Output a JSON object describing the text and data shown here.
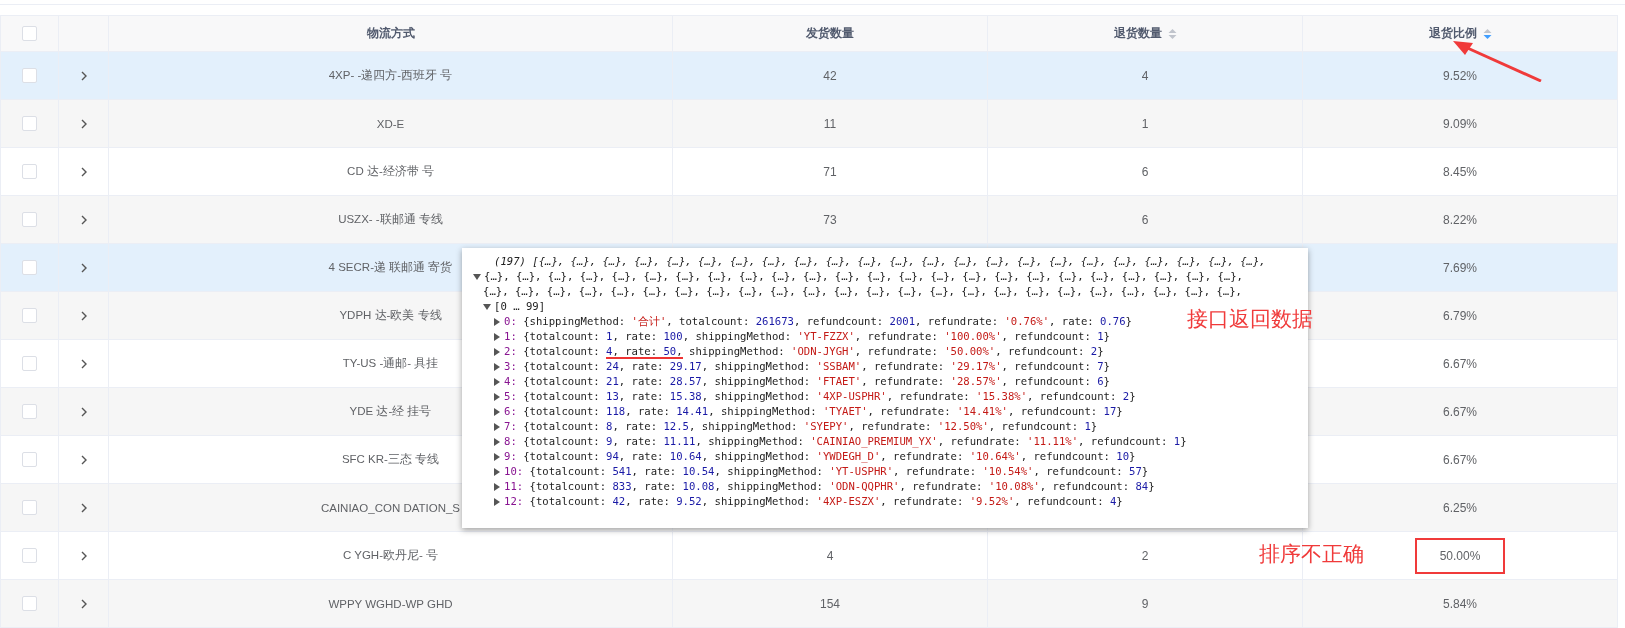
{
  "table": {
    "header_checkbox": {
      "checked": false
    },
    "columns": [
      {
        "label": "物流方式",
        "sortable": false
      },
      {
        "label": "发货数量",
        "sortable": false
      },
      {
        "label": "退货数量",
        "sortable": true,
        "sorted_descending": false
      },
      {
        "label": "退货比例",
        "sortable": true,
        "sorted_descending": true
      }
    ],
    "rows": [
      {
        "checked": false,
        "expanded": false,
        "highlighted": true,
        "boxed": false,
        "method": "4XP- -递四方-西班牙 号",
        "shipped": "42",
        "returned": "4",
        "ratio": "9.52%"
      },
      {
        "checked": false,
        "expanded": false,
        "highlighted": false,
        "boxed": false,
        "method": "XD-E",
        "shipped": "11",
        "returned": "1",
        "ratio": "9.09%"
      },
      {
        "checked": false,
        "expanded": false,
        "highlighted": false,
        "boxed": false,
        "method": "CD 达-经济带 号",
        "shipped": "71",
        "returned": "6",
        "ratio": "8.45%"
      },
      {
        "checked": false,
        "expanded": false,
        "highlighted": false,
        "boxed": false,
        "method": "USZX- -联邮通 专线",
        "shipped": "73",
        "returned": "6",
        "ratio": "8.22%"
      },
      {
        "checked": false,
        "expanded": false,
        "highlighted": true,
        "boxed": false,
        "method": "4 SECR-递 联邮通 寄货",
        "ratio": "7.69%"
      },
      {
        "checked": false,
        "expanded": false,
        "highlighted": false,
        "boxed": false,
        "method": "YDPH 达-欧美 专线",
        "ratio": "6.79%"
      },
      {
        "checked": false,
        "expanded": false,
        "highlighted": false,
        "boxed": false,
        "method": "TY-US -通邮- 具挂",
        "ratio": "6.67%"
      },
      {
        "checked": false,
        "expanded": false,
        "highlighted": false,
        "boxed": false,
        "method": "YDE 达-经 挂号",
        "ratio": "6.67%"
      },
      {
        "checked": false,
        "expanded": false,
        "highlighted": false,
        "boxed": false,
        "method": "SFC KR-三态 专线",
        "ratio": "6.67%"
      },
      {
        "checked": false,
        "expanded": false,
        "highlighted": false,
        "boxed": false,
        "method": "CAINIAO_CON DATION_S",
        "ratio": "6.25%"
      },
      {
        "checked": false,
        "expanded": false,
        "highlighted": false,
        "boxed": true,
        "method": "C YGH-欧丹尼- 号",
        "shipped": "4",
        "returned": "2",
        "ratio": "50.00%"
      },
      {
        "checked": false,
        "expanded": false,
        "highlighted": false,
        "boxed": false,
        "method": "WPPY WGHD-WP GHD",
        "shipped": "154",
        "returned": "9",
        "ratio": "5.84%"
      }
    ]
  },
  "console": {
    "lines": [
      {
        "kind": "summary",
        "text": "(197) [{…}, {…}, {…}, {…}, {…}, {…}, {…}, {…}, {…}, {…}, {…}, {…}, {…}, {…}, {…}, {…}, {…}, {…}, {…}, {…}, {…}, {…}, {…},"
      },
      {
        "kind": "plain",
        "expanded": true,
        "text": "{…}, {…}, {…}, {…}, {…}, {…}, {…}, {…}, {…}, {…}, {…}, {…}, {…}, {…}, {…}, {…}, {…}, {…}, {…}, {…}, {…}, {…}, {…}, {…},"
      },
      {
        "kind": "plain",
        "text": "{…}, {…}, {…}, {…}, {…}, {…}, {…}, {…}, {…}, {…}, {…}, {…}, {…}, {…}, {…}, {…}, {…}, {…}, {…}, {…}, {…}, {…}, {…}, {…},"
      },
      {
        "kind": "group",
        "expanded": true,
        "text": "[0 … 99]"
      }
    ],
    "entries": [
      {
        "expanded": false,
        "tokens": [
          {
            "kind": "index",
            "text": "0:"
          },
          {
            "kind": "plain",
            "text": " {shippingMethod: "
          },
          {
            "kind": "str",
            "text": "'合计'"
          },
          {
            "kind": "plain",
            "text": ", totalcount: "
          },
          {
            "kind": "num",
            "text": "261673"
          },
          {
            "kind": "plain",
            "text": ", refundcount: "
          },
          {
            "kind": "num",
            "text": "2001"
          },
          {
            "kind": "plain",
            "text": ", refundrate: "
          },
          {
            "kind": "str",
            "text": "'0.76%'"
          },
          {
            "kind": "plain",
            "text": ", rate: "
          },
          {
            "kind": "num",
            "text": "0.76"
          },
          {
            "kind": "plain",
            "text": "}"
          }
        ]
      },
      {
        "expanded": false,
        "tokens": [
          {
            "kind": "index",
            "text": "1:"
          },
          {
            "kind": "plain",
            "text": " {totalcount: "
          },
          {
            "kind": "num",
            "text": "1"
          },
          {
            "kind": "plain",
            "text": ", rate: "
          },
          {
            "kind": "num",
            "text": "100"
          },
          {
            "kind": "plain",
            "text": ", shippingMethod: "
          },
          {
            "kind": "str",
            "text": "'YT-FZZX'"
          },
          {
            "kind": "plain",
            "text": ", refundrate: "
          },
          {
            "kind": "str",
            "text": "'100.00%'"
          },
          {
            "kind": "plain",
            "text": ", refundcount: "
          },
          {
            "kind": "num",
            "text": "1"
          },
          {
            "kind": "plain",
            "text": "}"
          }
        ]
      },
      {
        "expanded": false,
        "tokens": [
          {
            "kind": "index",
            "text": "2:"
          },
          {
            "kind": "plain",
            "text": " {totalcount: "
          },
          {
            "kind": "underline",
            "parts": [
              {
                "kind": "num",
                "text": "4"
              },
              {
                "kind": "plain",
                "text": ", rate: "
              },
              {
                "kind": "num",
                "text": "50"
              },
              {
                "kind": "plain",
                "text": ","
              }
            ]
          },
          {
            "kind": "plain",
            "text": " shippingMethod: "
          },
          {
            "kind": "str",
            "text": "'ODN-JYGH'"
          },
          {
            "kind": "plain",
            "text": ", refundrate: "
          },
          {
            "kind": "str",
            "text": "'50.00%'"
          },
          {
            "kind": "plain",
            "text": ", refundcount: "
          },
          {
            "kind": "num",
            "text": "2"
          },
          {
            "kind": "plain",
            "text": "}"
          }
        ]
      },
      {
        "expanded": false,
        "tokens": [
          {
            "kind": "index",
            "text": "3:"
          },
          {
            "kind": "plain",
            "text": " {totalcount: "
          },
          {
            "kind": "num",
            "text": "24"
          },
          {
            "kind": "plain",
            "text": ", rate: "
          },
          {
            "kind": "num",
            "text": "29.17"
          },
          {
            "kind": "plain",
            "text": ", shippingMethod: "
          },
          {
            "kind": "str",
            "text": "'SSBAM'"
          },
          {
            "kind": "plain",
            "text": ", refundrate: "
          },
          {
            "kind": "str",
            "text": "'29.17%'"
          },
          {
            "kind": "plain",
            "text": ", refundcount: "
          },
          {
            "kind": "num",
            "text": "7"
          },
          {
            "kind": "plain",
            "text": "}"
          }
        ]
      },
      {
        "expanded": false,
        "tokens": [
          {
            "kind": "index",
            "text": "4:"
          },
          {
            "kind": "plain",
            "text": " {totalcount: "
          },
          {
            "kind": "num",
            "text": "21"
          },
          {
            "kind": "plain",
            "text": ", rate: "
          },
          {
            "kind": "num",
            "text": "28.57"
          },
          {
            "kind": "plain",
            "text": ", shippingMethod: "
          },
          {
            "kind": "str",
            "text": "'FTAET'"
          },
          {
            "kind": "plain",
            "text": ", refundrate: "
          },
          {
            "kind": "str",
            "text": "'28.57%'"
          },
          {
            "kind": "plain",
            "text": ", refundcount: "
          },
          {
            "kind": "num",
            "text": "6"
          },
          {
            "kind": "plain",
            "text": "}"
          }
        ]
      },
      {
        "expanded": false,
        "tokens": [
          {
            "kind": "index",
            "text": "5:"
          },
          {
            "kind": "plain",
            "text": " {totalcount: "
          },
          {
            "kind": "num",
            "text": "13"
          },
          {
            "kind": "plain",
            "text": ", rate: "
          },
          {
            "kind": "num",
            "text": "15.38"
          },
          {
            "kind": "plain",
            "text": ", shippingMethod: "
          },
          {
            "kind": "str",
            "text": "'4XP-USPHR'"
          },
          {
            "kind": "plain",
            "text": ", refundrate: "
          },
          {
            "kind": "str",
            "text": "'15.38%'"
          },
          {
            "kind": "plain",
            "text": ", refundcount: "
          },
          {
            "kind": "num",
            "text": "2"
          },
          {
            "kind": "plain",
            "text": "}"
          }
        ]
      },
      {
        "expanded": false,
        "tokens": [
          {
            "kind": "index",
            "text": "6:"
          },
          {
            "kind": "plain",
            "text": " {totalcount: "
          },
          {
            "kind": "num",
            "text": "118"
          },
          {
            "kind": "plain",
            "text": ", rate: "
          },
          {
            "kind": "num",
            "text": "14.41"
          },
          {
            "kind": "plain",
            "text": ", shippingMethod: "
          },
          {
            "kind": "str",
            "text": "'TYAET'"
          },
          {
            "kind": "plain",
            "text": ", refundrate: "
          },
          {
            "kind": "str",
            "text": "'14.41%'"
          },
          {
            "kind": "plain",
            "text": ", refundcount: "
          },
          {
            "kind": "num",
            "text": "17"
          },
          {
            "kind": "plain",
            "text": "}"
          }
        ]
      },
      {
        "expanded": false,
        "tokens": [
          {
            "kind": "index",
            "text": "7:"
          },
          {
            "kind": "plain",
            "text": " {totalcount: "
          },
          {
            "kind": "num",
            "text": "8"
          },
          {
            "kind": "plain",
            "text": ", rate: "
          },
          {
            "kind": "num",
            "text": "12.5"
          },
          {
            "kind": "plain",
            "text": ", shippingMethod: "
          },
          {
            "kind": "str",
            "text": "'SYEPY'"
          },
          {
            "kind": "plain",
            "text": ", refundrate: "
          },
          {
            "kind": "str",
            "text": "'12.50%'"
          },
          {
            "kind": "plain",
            "text": ", refundcount: "
          },
          {
            "kind": "num",
            "text": "1"
          },
          {
            "kind": "plain",
            "text": "}"
          }
        ]
      },
      {
        "expanded": false,
        "tokens": [
          {
            "kind": "index",
            "text": "8:"
          },
          {
            "kind": "plain",
            "text": " {totalcount: "
          },
          {
            "kind": "num",
            "text": "9"
          },
          {
            "kind": "plain",
            "text": ", rate: "
          },
          {
            "kind": "num",
            "text": "11.11"
          },
          {
            "kind": "plain",
            "text": ", shippingMethod: "
          },
          {
            "kind": "str",
            "text": "'CAINIAO_PREMIUM_YX'"
          },
          {
            "kind": "plain",
            "text": ", refundrate: "
          },
          {
            "kind": "str",
            "text": "'11.11%'"
          },
          {
            "kind": "plain",
            "text": ", refundcount: "
          },
          {
            "kind": "num",
            "text": "1"
          },
          {
            "kind": "plain",
            "text": "}"
          }
        ]
      },
      {
        "expanded": false,
        "tokens": [
          {
            "kind": "index",
            "text": "9:"
          },
          {
            "kind": "plain",
            "text": " {totalcount: "
          },
          {
            "kind": "num",
            "text": "94"
          },
          {
            "kind": "plain",
            "text": ", rate: "
          },
          {
            "kind": "num",
            "text": "10.64"
          },
          {
            "kind": "plain",
            "text": ", shippingMethod: "
          },
          {
            "kind": "str",
            "text": "'YWDEGH_D'"
          },
          {
            "kind": "plain",
            "text": ", refundrate: "
          },
          {
            "kind": "str",
            "text": "'10.64%'"
          },
          {
            "kind": "plain",
            "text": ", refundcount: "
          },
          {
            "kind": "num",
            "text": "10"
          },
          {
            "kind": "plain",
            "text": "}"
          }
        ]
      },
      {
        "expanded": false,
        "tokens": [
          {
            "kind": "index",
            "text": "10:"
          },
          {
            "kind": "plain",
            "text": " {totalcount: "
          },
          {
            "kind": "num",
            "text": "541"
          },
          {
            "kind": "plain",
            "text": ", rate: "
          },
          {
            "kind": "num",
            "text": "10.54"
          },
          {
            "kind": "plain",
            "text": ", shippingMethod: "
          },
          {
            "kind": "str",
            "text": "'YT-USPHR'"
          },
          {
            "kind": "plain",
            "text": ", refundrate: "
          },
          {
            "kind": "str",
            "text": "'10.54%'"
          },
          {
            "kind": "plain",
            "text": ", refundcount: "
          },
          {
            "kind": "num",
            "text": "57"
          },
          {
            "kind": "plain",
            "text": "}"
          }
        ]
      },
      {
        "expanded": false,
        "tokens": [
          {
            "kind": "index",
            "text": "11:"
          },
          {
            "kind": "plain",
            "text": " {totalcount: "
          },
          {
            "kind": "num",
            "text": "833"
          },
          {
            "kind": "plain",
            "text": ", rate: "
          },
          {
            "kind": "num",
            "text": "10.08"
          },
          {
            "kind": "plain",
            "text": ", shippingMethod: "
          },
          {
            "kind": "str",
            "text": "'ODN-QQPHR'"
          },
          {
            "kind": "plain",
            "text": ", refundrate: "
          },
          {
            "kind": "str",
            "text": "'10.08%'"
          },
          {
            "kind": "plain",
            "text": ", refundcount: "
          },
          {
            "kind": "num",
            "text": "84"
          },
          {
            "kind": "plain",
            "text": "}"
          }
        ]
      },
      {
        "expanded": false,
        "tokens": [
          {
            "kind": "index",
            "text": "12:"
          },
          {
            "kind": "plain",
            "text": " {totalcount: "
          },
          {
            "kind": "num",
            "text": "42"
          },
          {
            "kind": "plain",
            "text": ", rate: "
          },
          {
            "kind": "num",
            "text": "9.52"
          },
          {
            "kind": "plain",
            "text": ", shippingMethod: "
          },
          {
            "kind": "str",
            "text": "'4XP-ESZX'"
          },
          {
            "kind": "plain",
            "text": ", refundrate: "
          },
          {
            "kind": "str",
            "text": "'9.52%'"
          },
          {
            "kind": "plain",
            "text": ", refundcount: "
          },
          {
            "kind": "num",
            "text": "4"
          },
          {
            "kind": "plain",
            "text": "}"
          }
        ]
      }
    ]
  },
  "annotations": [
    {
      "kind": "arrow"
    },
    {
      "kind": "label",
      "text": "接口返回数据"
    },
    {
      "kind": "label",
      "text": "排序不正确"
    }
  ]
}
